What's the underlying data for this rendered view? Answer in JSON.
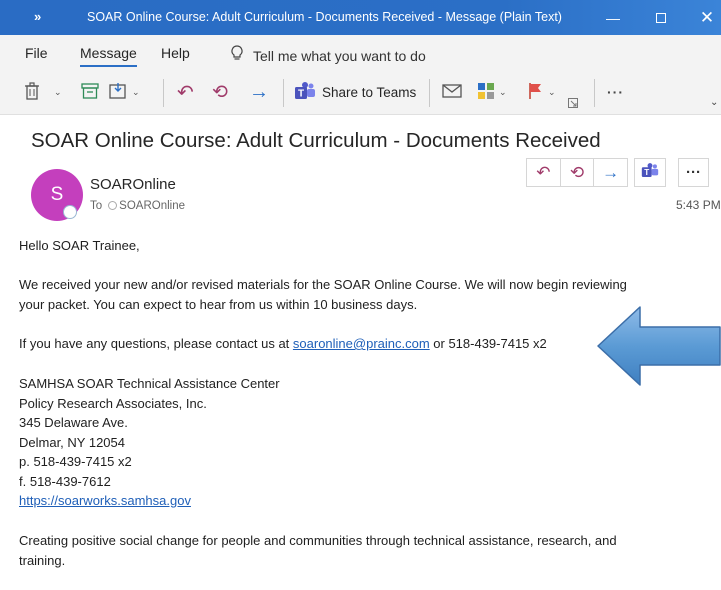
{
  "window": {
    "expand_glyph": "»",
    "title": "SOAR Online Course: Adult Curriculum - Documents Received  -  Message (Plain Text)",
    "minimize_glyph": "—",
    "close_glyph": "✕"
  },
  "menu": {
    "items": [
      "File",
      "Message",
      "Help"
    ],
    "active": "Message",
    "tell_me": "Tell me what you want to do"
  },
  "ribbon": {
    "icons": [
      "delete-icon",
      "archive-icon",
      "move-icon",
      "reply-icon",
      "reply-all-icon",
      "forward-icon",
      "teams-icon",
      "envelope-icon",
      "categorize-icon",
      "flag-icon",
      "more-icon"
    ],
    "share_to_teams_label": "Share to Teams",
    "more_glyph": "···",
    "accent_color": "#a03b6a"
  },
  "email": {
    "subject": "SOAR Online Course: Adult Curriculum - Documents Received",
    "avatar_initial": "S",
    "avatar_color": "#c43fbd",
    "sender": "SOAROnline",
    "to_label": "To",
    "to_recipient": "SOAROnline",
    "time": "5:43 PM",
    "actions": {
      "reply_glyph": "↶",
      "reply_all_glyph": "⟲",
      "forward_glyph": "→",
      "more_glyph": "···"
    },
    "greeting": "Hello SOAR Trainee,",
    "para1_line1": "We received your new and/or revised materials for the SOAR Online Course. We will now begin reviewing",
    "para1_line2": "your packet. You can expect to hear from us within 10 business days.",
    "contact_prefix": "If you have any questions, please contact us at ",
    "contact_email": "soaronline@prainc.com",
    "contact_suffix": " or 518-439-7415 x2",
    "signature": [
      "SAMHSA SOAR Technical Assistance Center",
      "Policy Research Associates, Inc.",
      "345 Delaware Ave.",
      "Delmar, NY 12054",
      "p. 518-439-7415 x2",
      "f. 518-439-7612"
    ],
    "website": "https://soarworks.samhsa.gov",
    "closing_line1": "Creating positive social change for people and communities through technical assistance, research, and",
    "closing_line2": "training."
  },
  "annotation": {
    "arrow_color": "#5b9bd5",
    "arrow_direction": "left"
  }
}
